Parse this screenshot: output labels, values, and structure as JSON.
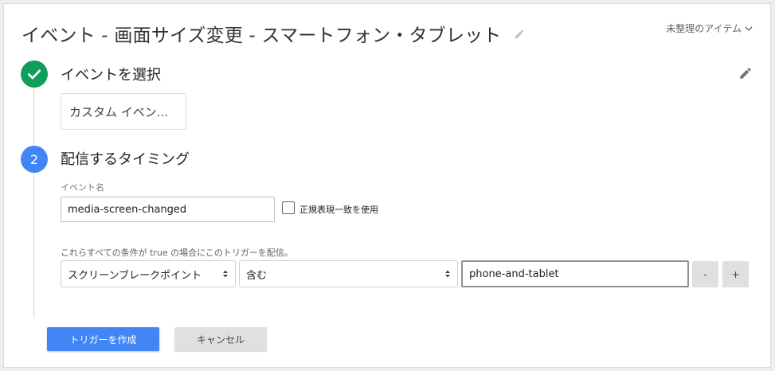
{
  "header": {
    "title": "イベント - 画面サイズ変更 - スマートフォン・タブレット",
    "folder": "未整理のアイテム"
  },
  "step1": {
    "title": "イベントを選択",
    "event_type": "カスタム イベン..."
  },
  "step2": {
    "number": "2",
    "title": "配信するタイミング",
    "event_name_label": "イベント名",
    "event_name_value": "media-screen-changed",
    "regex_label": "正規表現一致を使用",
    "regex_checked": false,
    "condition_text": "これらすべての条件が true の場合にこのトリガーを配信。",
    "condition": {
      "variable": "スクリーンブレークポイント",
      "operator": "含む",
      "value": "phone-and-tablet"
    },
    "remove_label": "-",
    "add_label": "+"
  },
  "footer": {
    "create_label": "トリガーを作成",
    "cancel_label": "キャンセル"
  },
  "colors": {
    "primary": "#4285f4",
    "success": "#0f9d58"
  }
}
